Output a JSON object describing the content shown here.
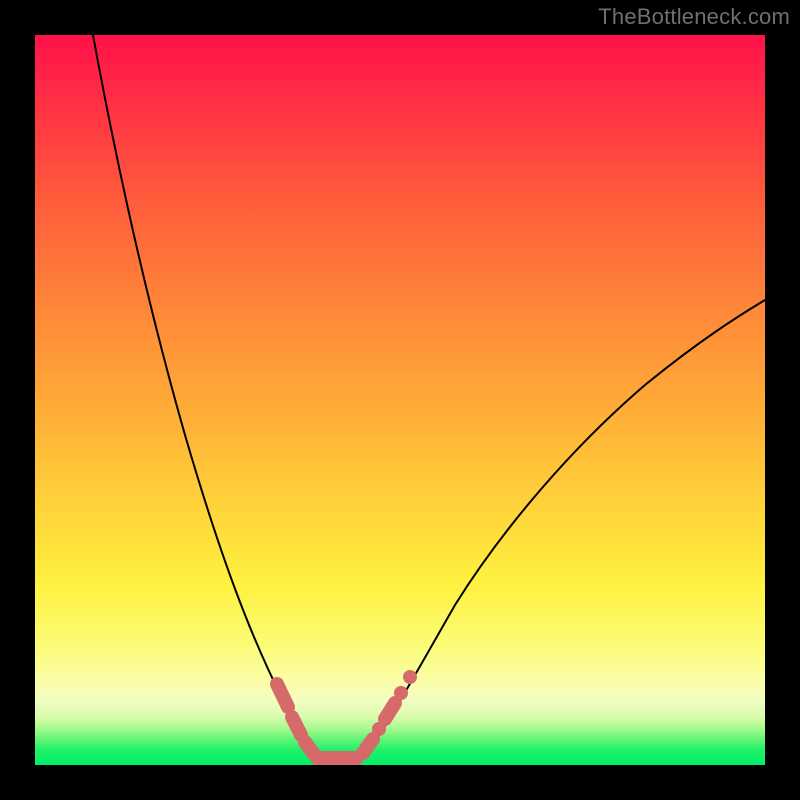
{
  "watermark": "TheBottleneck.com",
  "chart_data": {
    "type": "line",
    "title": "",
    "xlabel": "",
    "ylabel": "",
    "xlim": [
      0,
      100
    ],
    "ylim": [
      0,
      100
    ],
    "grid": false,
    "legend": false,
    "background_gradient": {
      "top": "#ff1149",
      "mid": "#ffd13a",
      "bottom": "#00ef6a",
      "meaning": "red=high bottleneck, green=low bottleneck"
    },
    "series": [
      {
        "name": "bottleneck-curve",
        "comment": "V-shaped bottleneck curve; minimum around x≈37 near y≈0",
        "x": [
          8,
          12,
          16,
          20,
          24,
          28,
          31,
          33,
          35,
          37,
          39,
          41,
          43,
          46,
          52,
          60,
          70,
          82,
          94,
          100
        ],
        "y": [
          100,
          84,
          68,
          53,
          40,
          28,
          18,
          10,
          4,
          1,
          1,
          3,
          7,
          13,
          22,
          34,
          46,
          56,
          62,
          64
        ]
      },
      {
        "name": "optimal-range-markers",
        "comment": "highlighted dashed/segmented salmon markers near the curve minimum",
        "x": [
          30,
          32,
          34,
          36,
          38,
          40,
          42,
          44,
          45.5
        ],
        "y": [
          16,
          9,
          3,
          1,
          1,
          2,
          5,
          10,
          14
        ]
      }
    ]
  }
}
